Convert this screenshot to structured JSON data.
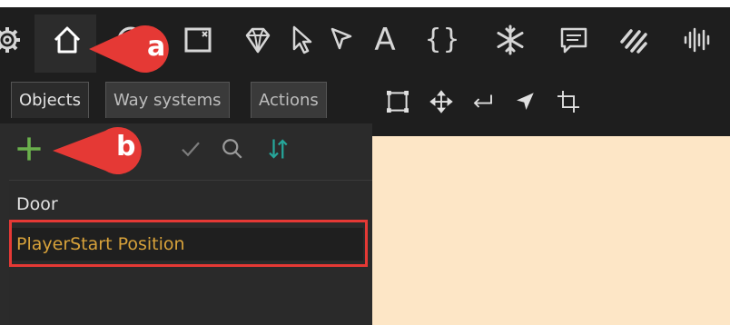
{
  "toolbar": {
    "icons": [
      "gear-icon",
      "home-icon",
      "globe-icon",
      "frame-icon",
      "diamond-icon",
      "cursor-icon",
      "cursor-outline-icon",
      "text-icon",
      "braces-icon",
      "snowflake-icon",
      "message-icon",
      "stripes-icon",
      "audio-wave-icon"
    ],
    "text_icon_glyph": "A",
    "braces_glyph": "{}"
  },
  "tabs": [
    {
      "label": "Objects",
      "active": true
    },
    {
      "label": "Way systems",
      "active": false
    },
    {
      "label": "Actions",
      "active": false
    }
  ],
  "panel_toolbar": {
    "icons": [
      "add-icon",
      "check-icon",
      "search-icon",
      "sort-icon"
    ]
  },
  "objects_list": {
    "items": [
      {
        "label": "Door",
        "selected": false
      },
      {
        "label": "PlayerStart Position",
        "selected": true
      }
    ]
  },
  "right_toolbar": {
    "icons": [
      "select-rect-icon",
      "move-icon",
      "enter-icon",
      "navigate-icon",
      "crop-icon"
    ]
  },
  "callouts": [
    {
      "label": "a"
    },
    {
      "label": "b"
    }
  ],
  "colors": {
    "toolbar_bg": "#1e1e1e",
    "panel_bg": "#2b2b2b",
    "canvas_bg": "#fde6c6",
    "selected_text": "#d8a23a",
    "highlight": "#e53935",
    "callout_fill": "#e53935",
    "add_green": "#6ab04c",
    "sort_teal": "#26a69a"
  }
}
